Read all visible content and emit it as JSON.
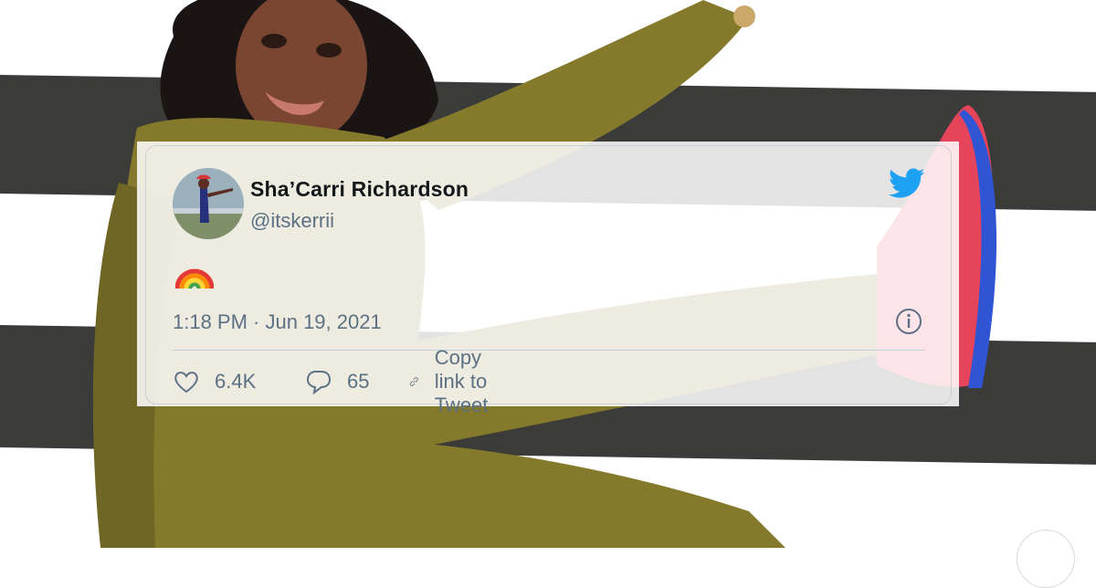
{
  "tweet": {
    "author_name": "Sha’Carri Richardson",
    "author_handle": "@itskerrii",
    "body": "🌈",
    "timestamp": "1:18 PM · Jun 19, 2021",
    "likes": "6.4K",
    "replies": "65",
    "copy_link_label": "Copy link to Tweet"
  },
  "icons": {
    "brand": "twitter-bird-icon",
    "info": "info-icon",
    "like": "heart-icon",
    "reply": "speech-bubble-icon",
    "copy": "link-icon"
  },
  "colors": {
    "twitter_blue": "#1da1f2",
    "name_text": "#14171a",
    "secondary_text": "#5b7083",
    "outfit_olive": "#857a2c",
    "wall_stripe": "#3b3b39"
  }
}
